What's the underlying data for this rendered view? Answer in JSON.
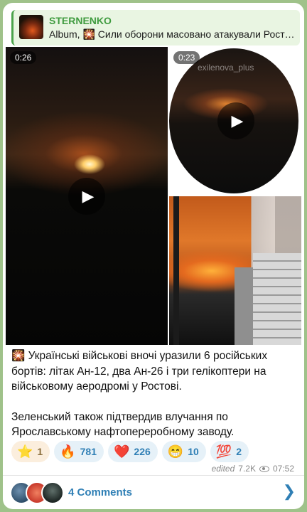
{
  "reply": {
    "channel": "STERNENKO",
    "preview": "Album, 🎇 Сили оборони масовано атакували Ростов..."
  },
  "media": [
    {
      "duration": "0:26",
      "kind": "video"
    },
    {
      "duration": "0:23",
      "kind": "round-video",
      "watermark": "exilenova_plus"
    },
    {
      "kind": "photo"
    }
  ],
  "message": {
    "paragraph1": "🎇 Українські військові вночі уразили 6 російських бортів: літак Ан-12, два Ан-26 і три гелікоптери на військовому аеродромі у Ростові.",
    "paragraph2": "Зеленський також підтвердив влучання по Ярославському нафтопереробному заводу."
  },
  "reactions": [
    {
      "emoji": "⭐",
      "count": "1"
    },
    {
      "emoji": "🔥",
      "count": "781"
    },
    {
      "emoji": "❤️",
      "count": "226"
    },
    {
      "emoji": "😁",
      "count": "10"
    },
    {
      "emoji": "💯",
      "count": "2"
    }
  ],
  "meta": {
    "edited": "edited",
    "views": "7.2K",
    "time": "07:52"
  },
  "comments": {
    "label": "4 Comments"
  },
  "icons": {
    "play": "play-icon",
    "views": "eye-icon",
    "chevron": "chevron-right-icon"
  }
}
